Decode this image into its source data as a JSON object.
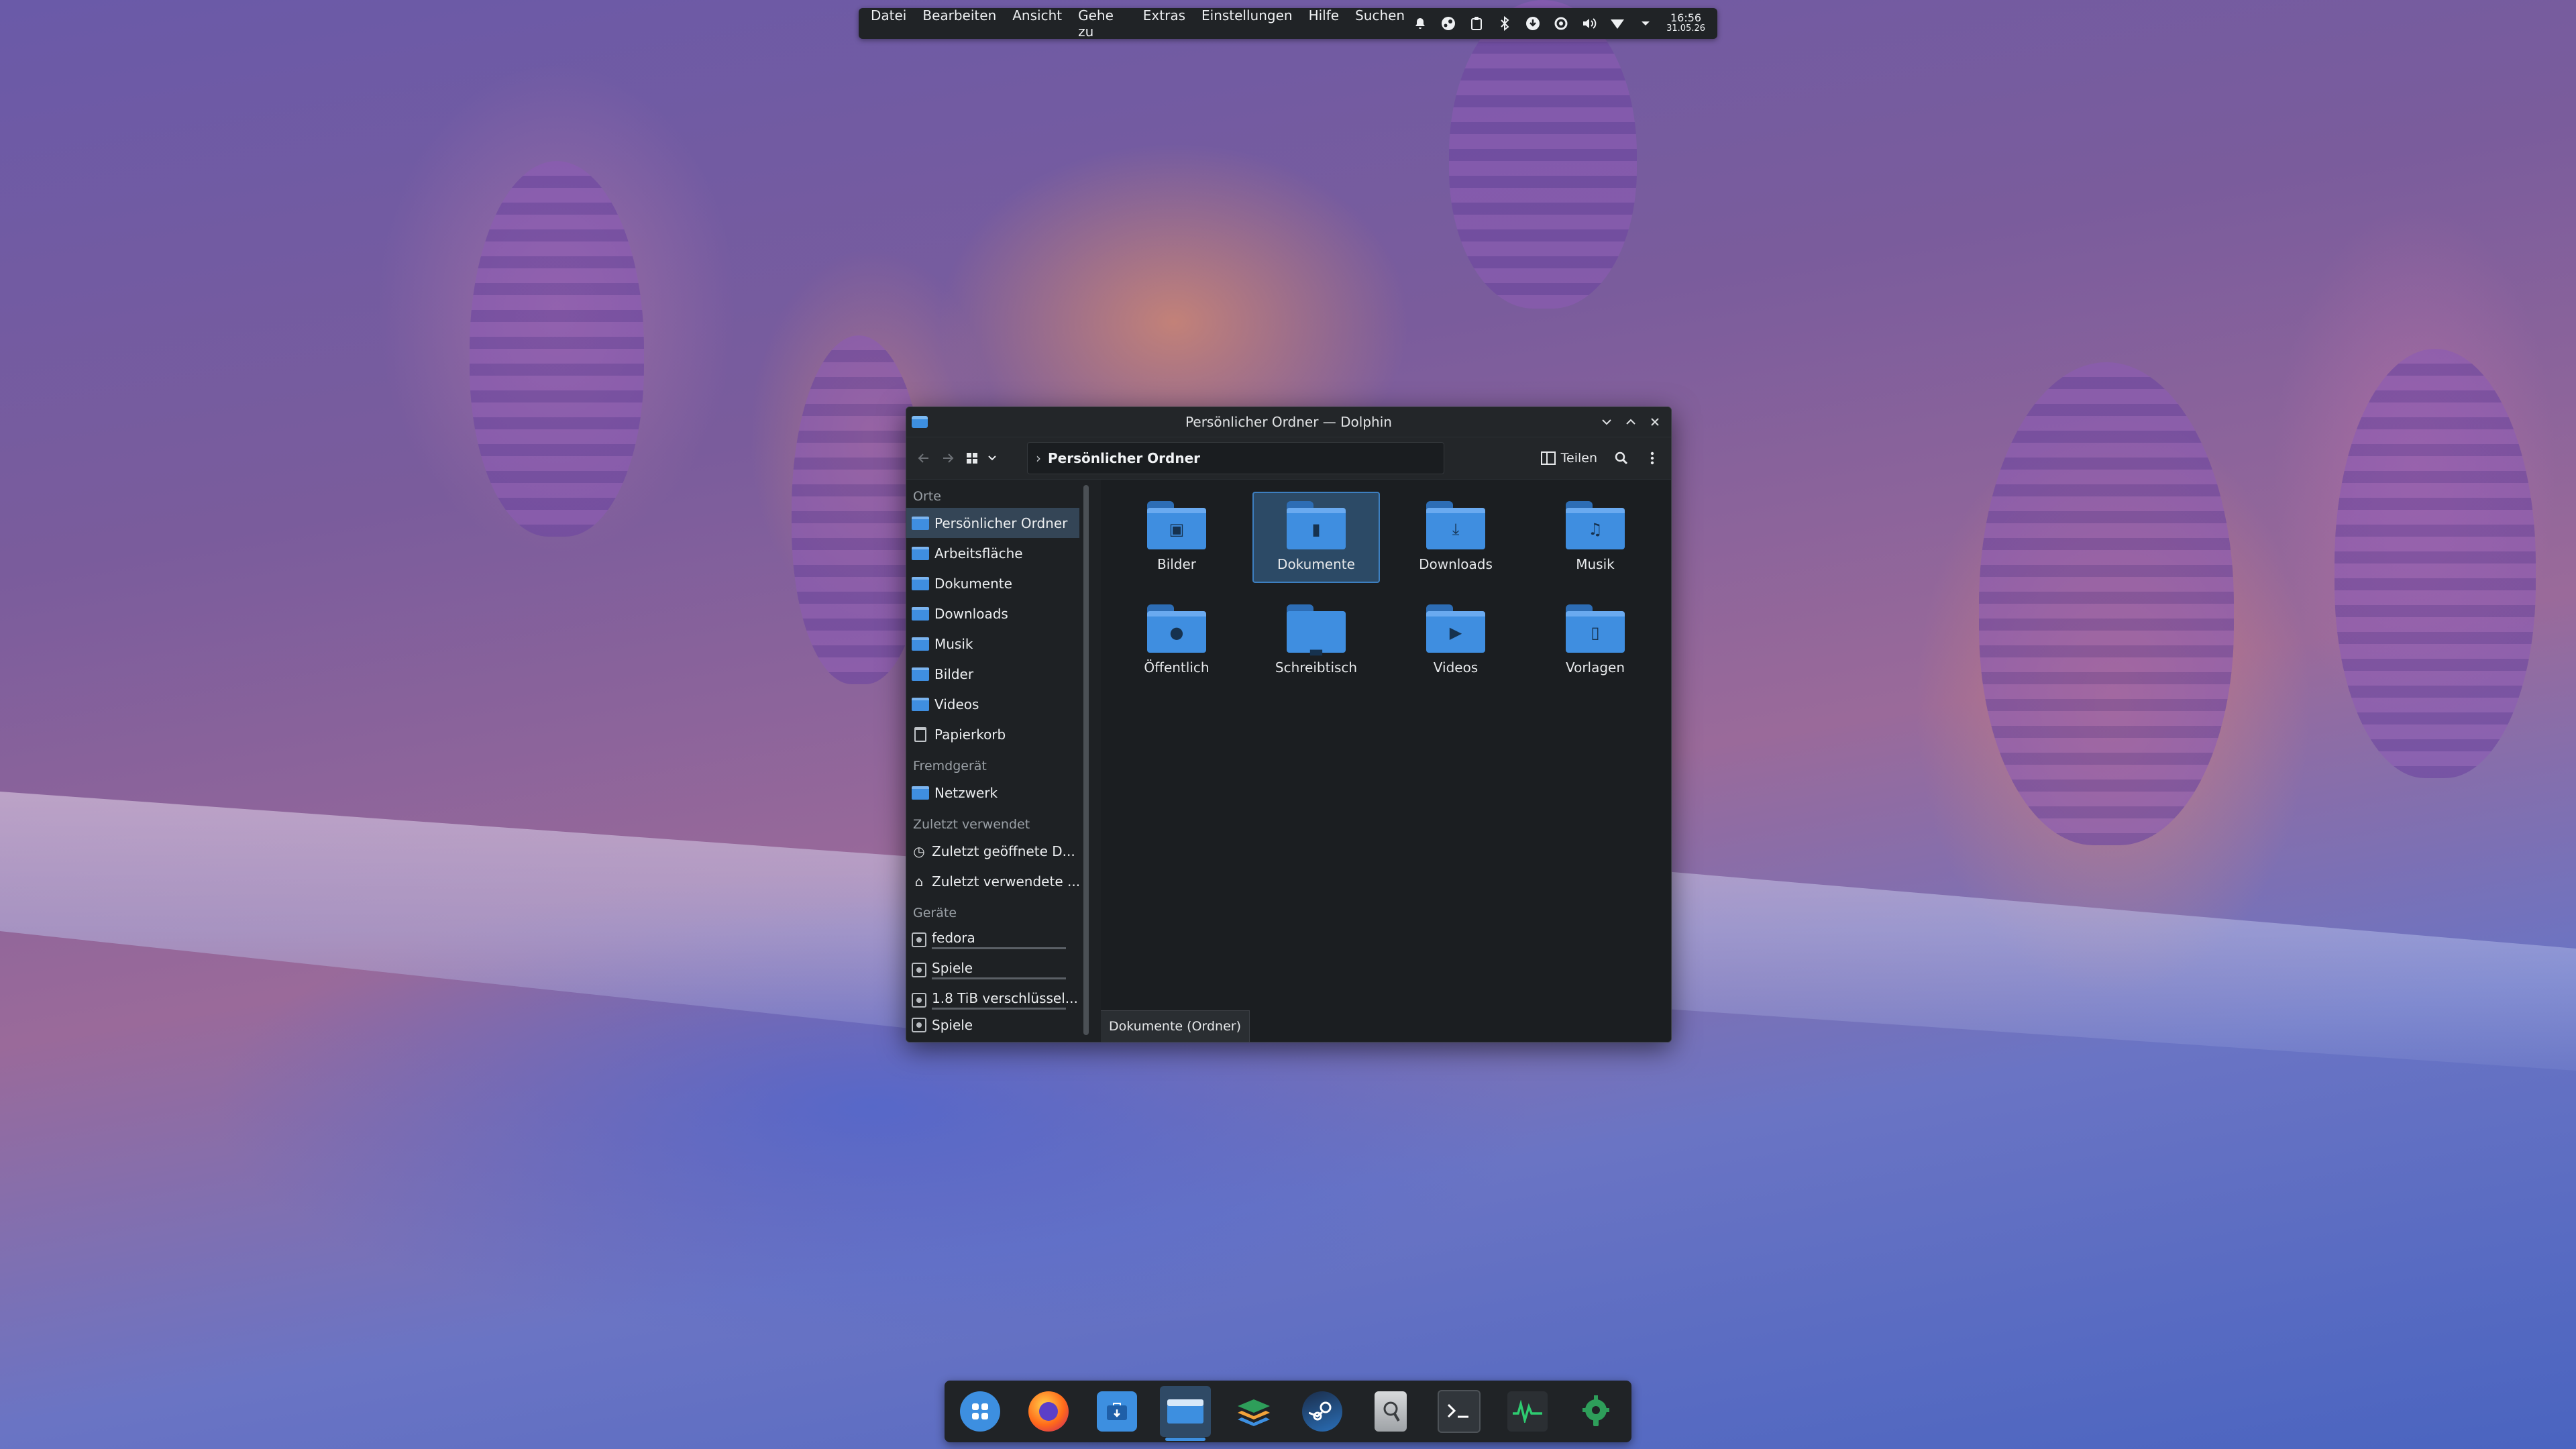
{
  "topbar": {
    "menu": [
      "Datei",
      "Bearbeiten",
      "Ansicht",
      "Gehe zu",
      "Extras",
      "Einstellungen",
      "Hilfe",
      "Suchen"
    ],
    "clock_time": "16:56",
    "clock_date": "31.05.26",
    "tray_icons": [
      "bell-icon",
      "steam-tray-icon",
      "clipboard-icon",
      "bluetooth-icon",
      "update-icon",
      "settings-tray-icon",
      "volume-icon",
      "network-icon",
      "expand-tray-icon"
    ]
  },
  "window": {
    "title": "Persönlicher Ordner — Dolphin",
    "toolbar": {
      "breadcrumb": "Persönlicher Ordner",
      "split_label": "Teilen"
    },
    "sidebar": {
      "sections": {
        "orte": "Orte",
        "fremdgeraet": "Fremdgerät",
        "zuletzt": "Zuletzt verwendet",
        "geraete": "Geräte"
      },
      "places": [
        "Persönlicher Ordner",
        "Arbeitsfläche",
        "Dokumente",
        "Downloads",
        "Musik",
        "Bilder",
        "Videos",
        "Papierkorb"
      ],
      "remote": [
        "Netzwerk"
      ],
      "recent": [
        "Zuletzt geöffnete D...",
        "Zuletzt verwendete ..."
      ],
      "devices": [
        "fedora",
        "Spiele",
        "1.8 TiB verschlüssel...",
        "Spiele"
      ]
    },
    "files": [
      "Bilder",
      "Dokumente",
      "Downloads",
      "Musik",
      "Öffentlich",
      "Schreibtisch",
      "Videos",
      "Vorlagen"
    ],
    "status": "Dokumente (Ordner)"
  },
  "colors": {
    "folder": "#3f8ee0",
    "selection": "#2c4a66",
    "panel": "#202326"
  },
  "dock": [
    "app-launcher",
    "firefox",
    "discover",
    "dolphin",
    "stacks",
    "steam",
    "kwallet",
    "terminal",
    "system-monitor",
    "kde-connect"
  ]
}
